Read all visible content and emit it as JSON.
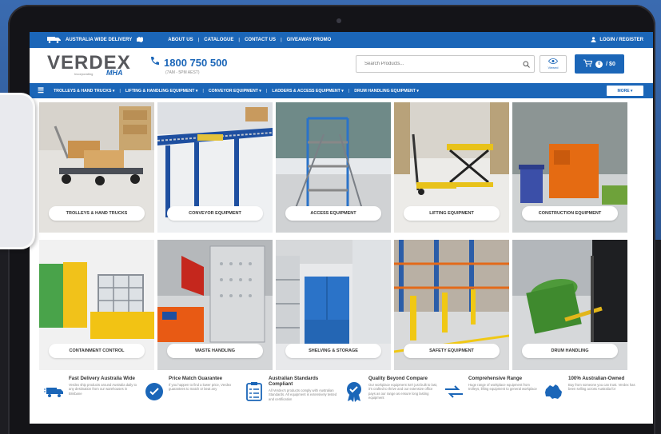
{
  "topbar": {
    "delivery": "AUSTRALIA WIDE DELIVERY",
    "links": [
      "ABOUT US",
      "CATALOGUE",
      "CONTACT US",
      "GIVEAWAY PROMO"
    ],
    "login": "LOGIN / REGISTER"
  },
  "header": {
    "logo_main": "VERDEX",
    "logo_sub": "Incorporating",
    "logo_mha": "MHA",
    "phone": "1800 750 500",
    "hours": "(7AM - 5PM AEST)",
    "search_placeholder": "Search Products...",
    "viewed_label": "Viewed",
    "cart_count": "0",
    "cart_total": "/ $0"
  },
  "nav": {
    "items": [
      "TROLLEYS & HAND TRUCKS ▾",
      "LIFTING & HANDLING EQUIPMENT ▾",
      "CONVEYOR EQUIPMENT ▾",
      "LADDERS & ACCESS EQUIPMENT ▾",
      "DRUM HANDLING EQUIPMENT ▾"
    ],
    "more": "MORE ▾"
  },
  "categories": [
    "TROLLEYS & HAND TRUCKS",
    "CONVEYOR EQUIPMENT",
    "ACCESS EQUIPMENT",
    "LIFTING EQUIPMENT",
    "CONSTRUCTION EQUIPMENT",
    "CONTAINMENT CONTROL",
    "WASTE HANDLING",
    "SHELVING & STORAGE",
    "SAFETY EQUIPMENT",
    "DRUM HANDLING"
  ],
  "features": [
    {
      "title": "Fast Delivery Australia Wide",
      "desc": "Verdex ship products around Australia daily to any destination from our warehouses in Brisbane"
    },
    {
      "title": "Price Match Guarantee",
      "desc": "If you happen to find a lower price, Verdex guarantees to match or beat any"
    },
    {
      "title": "Australian Standards Compliant",
      "desc": "All Verdex's products comply with Australian Standards. All equipment is extensively tested and certification"
    },
    {
      "title": "Quality Beyond Compare",
      "desc": "Our workplace equipment isn't just built to last, it's crafted to thrive and our extensive office pays as our range as ensure long lasting equipment"
    },
    {
      "title": "Comprehensive Range",
      "desc": "Huge range of workplace equipment from trolleys, lifting equipment to general workplace"
    },
    {
      "title": "100% Australian-Owned",
      "desc": "Buy from someone you can trust. Verdex has been selling across Australia for"
    }
  ]
}
